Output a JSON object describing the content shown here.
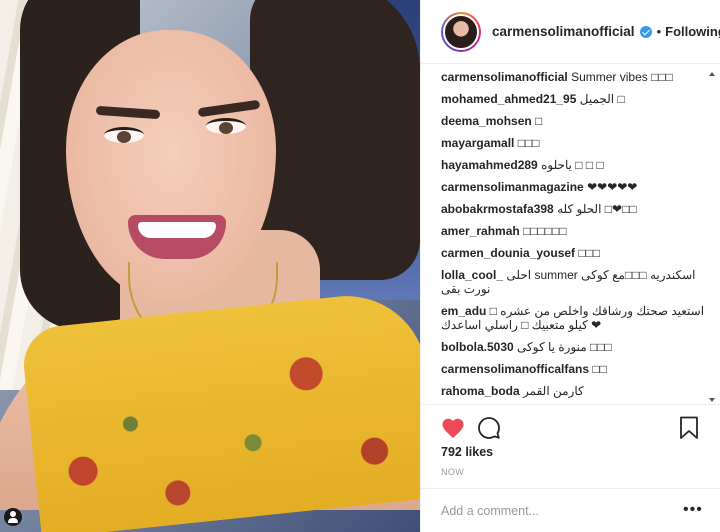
{
  "header": {
    "username": "carmensolimanofficial",
    "dot": "•",
    "follow_label": "Following"
  },
  "comments": [
    {
      "user": "carmensolimanofficial",
      "text": "Summer vibes □□□"
    },
    {
      "user": "mohamed_ahmed21_95",
      "text": "الجميل □"
    },
    {
      "user": "deema_mohsen",
      "text": "□"
    },
    {
      "user": "mayargamall",
      "text": "□□□"
    },
    {
      "user": "hayamahmed289",
      "text": "ياحلوه □ □ □"
    },
    {
      "user": "carmensolimanmagazine",
      "text": "❤❤❤❤❤"
    },
    {
      "user": "abobakrmostafa398",
      "text": "الحلو كله □❤□□"
    },
    {
      "user": "amer_rahmah",
      "text": "□□□□□□"
    },
    {
      "user": "carmen_dounia_yousef",
      "text": "□□□"
    },
    {
      "user": "lolla_cool_",
      "text": "احلى summer اسكندريه □□□مع كوكى نورت بقى"
    },
    {
      "user": "em_adu",
      "text": "□ استعيد صحتك ورشاقك واخلص من عشره كيلو متعبيك □ راسلي اساعدك ❤"
    },
    {
      "user": "bolbola.5030",
      "text": "منورة يا كوكى □□□"
    },
    {
      "user": "carmensolimanofficalfans",
      "text": "□□"
    },
    {
      "user": "rahoma_boda",
      "text": "كارمن القمر"
    }
  ],
  "likes": "792 likes",
  "time": "NOW",
  "add_comment": {
    "placeholder": "Add a comment..."
  },
  "more": "•••",
  "colors": {
    "heart": "#ed4956",
    "verified": "#3897f0",
    "muted": "#999999"
  },
  "icons": [
    "heart-icon",
    "comment-icon",
    "bookmark-icon",
    "more-options-icon",
    "verified-badge-icon",
    "camera-icon"
  ]
}
